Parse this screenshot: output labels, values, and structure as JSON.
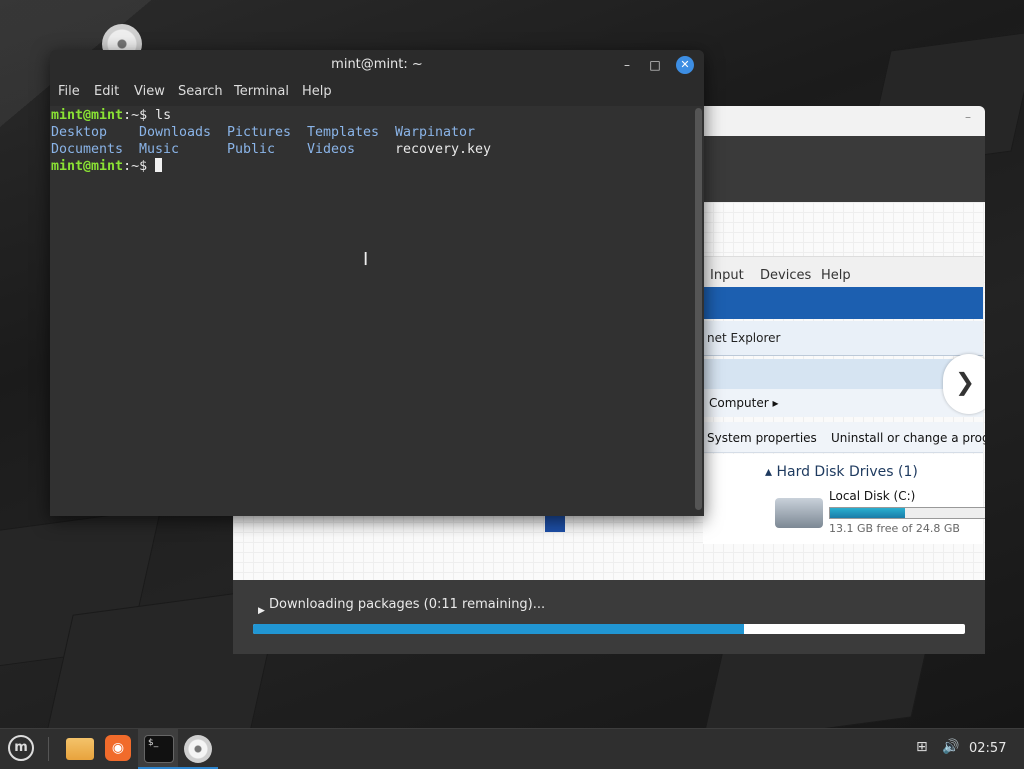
{
  "terminal": {
    "title": "mint@mint: ~",
    "menu": [
      "File",
      "Edit",
      "View",
      "Search",
      "Terminal",
      "Help"
    ],
    "prompt_user": "mint@mint",
    "prompt_sep": ":~$",
    "command": " ls",
    "row1": [
      "Desktop",
      "Downloads",
      "Pictures",
      "Templates",
      "Warpinator"
    ],
    "row2": [
      "Documents",
      "Music",
      "Public",
      "Videos",
      "recovery.key"
    ],
    "window_buttons": {
      "minimize": "–",
      "maximize": "□",
      "close": "✕"
    }
  },
  "installer": {
    "vm_menu": [
      "Input",
      "Devices",
      "Help"
    ],
    "ie_label": "net Explorer",
    "breadcrumb": "Computer ▸",
    "toolbar": [
      "System properties",
      "Uninstall or change a program"
    ],
    "drives_title": "▴ Hard Disk Drives (1)",
    "disk_name": "Local Disk (C:)",
    "disk_free": "13.1 GB free of 24.8 GB",
    "disk_used_fraction": 0.47,
    "next_arrow": "❯",
    "download_text": "Downloading packages (0:11 remaining)...",
    "download_progress": 0.69
  },
  "taskbar": {
    "clock": "02:57",
    "menu_logo": "m",
    "terminal_icon_text": "$_",
    "items": [
      "mint-menu",
      "file-manager",
      "firefox",
      "terminal",
      "installer"
    ]
  }
}
